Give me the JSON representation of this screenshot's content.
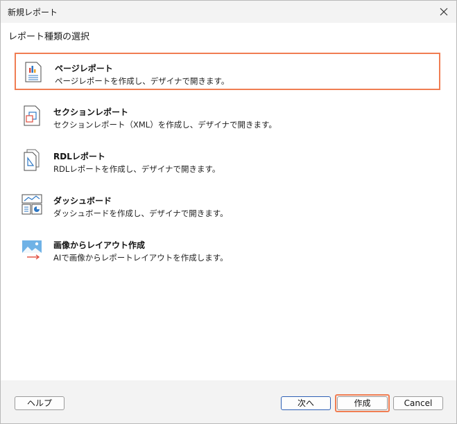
{
  "window": {
    "title": "新規レポート"
  },
  "subtitle": "レポート種類の選択",
  "items": [
    {
      "name": "ページレポート",
      "description": "ページレポートを作成し、デザイナで開きます。",
      "icon": "page-report-icon"
    },
    {
      "name": "セクションレポート",
      "description": "セクションレポート（XML）を作成し、デザイナで開きます。",
      "icon": "section-report-icon"
    },
    {
      "name": "RDLレポート",
      "description": "RDLレポートを作成し、デザイナで開きます。",
      "icon": "rdl-report-icon"
    },
    {
      "name": "ダッシュボード",
      "description": "ダッシュボードを作成し、デザイナで開きます。",
      "icon": "dashboard-icon"
    },
    {
      "name": "画像からレイアウト作成",
      "description": "AIで画像からレポートレイアウトを作成します。",
      "icon": "image-layout-icon"
    }
  ],
  "buttons": {
    "help": "ヘルプ",
    "next": "次へ",
    "create": "作成",
    "cancel": "Cancel"
  },
  "colors": {
    "highlight": "#f07d52",
    "icon_blue": "#2f78c4",
    "default_button_border": "#2d5fb5"
  }
}
